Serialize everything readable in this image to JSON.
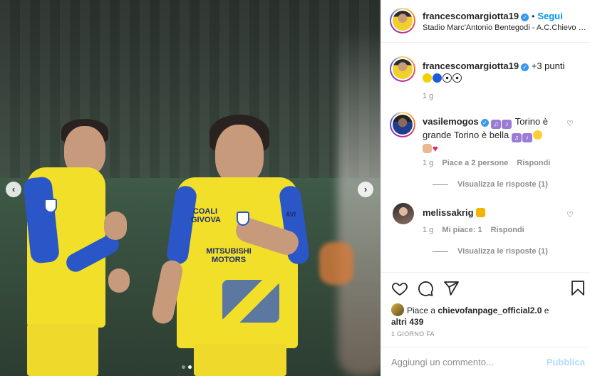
{
  "header": {
    "username": "francescomargiotta19",
    "follow_label": "Segui",
    "separator": "•",
    "location": "Stadio Marc'Antonio Bentegodi - A.C.Chievo Verona"
  },
  "caption": {
    "username": "francescomargiotta19",
    "text": "+3 punti",
    "emojis": [
      "yellow-circle",
      "blue-circle",
      "soccer-ball",
      "soccer-ball"
    ],
    "time": "1 g"
  },
  "comments": [
    {
      "username": "vasilemogos",
      "text_part1": "Torino è grande Torino è bella",
      "emojis_lead": [
        "musical-notes",
        "musical-keyboard"
      ],
      "emojis_trail": [
        "musical-notes",
        "musical-keyboard",
        "laughing"
      ],
      "emojis_line2": [
        "flexed-biceps",
        "red-heart"
      ],
      "time": "1 g",
      "likes": "Piace a 2 persone",
      "reply_label": "Rispondi",
      "view_replies": "Visualizza le risposte (1)"
    },
    {
      "username": "melissakrig",
      "emoji": "crown",
      "time": "1 g",
      "likes": "Mi piace: 1",
      "reply_label": "Rispondi",
      "view_replies": "Visualizza le risposte (1)"
    }
  ],
  "likes": {
    "prefix": "Piace a ",
    "user": "chievofanpage_official2.0",
    "suffix": " e",
    "others": "altri 439"
  },
  "post_time": "1 GIORNO FA",
  "add_comment": {
    "placeholder": "Aggiungi un commento...",
    "publish_label": "Pubblica"
  },
  "photo": {
    "sponsor_1": "MITSUBISHI MOTORS",
    "sponsor_2": "COALI GIVOVA",
    "sponsor_3": "AVI",
    "slide_count": 2,
    "active_slide": 2
  },
  "colors": {
    "link_blue": "#0095f6",
    "publish_disabled": "#b3dbff",
    "kit_yellow": "#f2df2a",
    "kit_blue": "#2a56c8"
  }
}
